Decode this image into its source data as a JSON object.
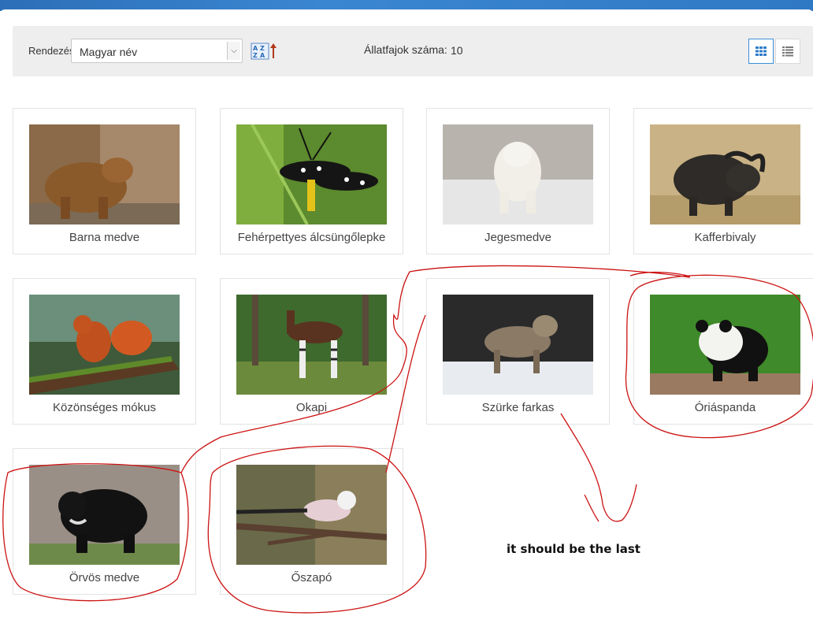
{
  "toolbar": {
    "sort_label": "Rendezés",
    "sort_value": "Magyar név",
    "count_label": "Állatfajok száma:",
    "count_value": "10"
  },
  "animals": [
    {
      "name": "Barna medve"
    },
    {
      "name": "Fehérpettyes álcsüngőlepke"
    },
    {
      "name": "Jegesmedve"
    },
    {
      "name": "Kafferbivaly"
    },
    {
      "name": "Közönséges mókus"
    },
    {
      "name": "Okapi"
    },
    {
      "name": "Szürke farkas"
    },
    {
      "name": "Óriáspanda"
    },
    {
      "name": "Örvös medve"
    },
    {
      "name": "Őszapó"
    }
  ],
  "annotation": {
    "note": "it should be the last",
    "color": "#cc1111"
  },
  "colors": {
    "accent": "#3b8fd9",
    "toolbar_bg": "#eeeeee"
  }
}
